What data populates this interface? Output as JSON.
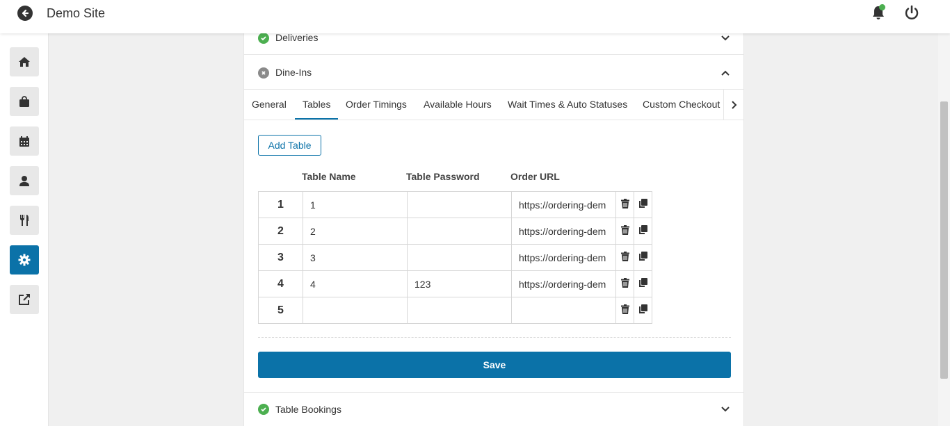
{
  "header": {
    "title": "Demo Site"
  },
  "sidebar": {
    "items": [
      {
        "icon": "home-icon"
      },
      {
        "icon": "shopping-bag-icon"
      },
      {
        "icon": "calendar-icon"
      },
      {
        "icon": "user-icon"
      },
      {
        "icon": "utensils-icon"
      },
      {
        "icon": "gear-icon",
        "active": true
      },
      {
        "icon": "external-link-icon"
      }
    ]
  },
  "sections": {
    "deliveries": "Deliveries",
    "dine_ins": "Dine-Ins",
    "table_bookings": "Table Bookings"
  },
  "tabs": [
    "General",
    "Tables",
    "Order Timings",
    "Available Hours",
    "Wait Times & Auto Statuses",
    "Custom Checkout F"
  ],
  "active_tab": "Tables",
  "buttons": {
    "add_table": "Add Table",
    "save": "Save"
  },
  "table": {
    "headers": {
      "name": "Table Name",
      "password": "Table Password",
      "url": "Order URL"
    },
    "rows": [
      {
        "num": "1",
        "name": "1",
        "password": "",
        "url": "https://ordering-dem"
      },
      {
        "num": "2",
        "name": "2",
        "password": "",
        "url": "https://ordering-dem"
      },
      {
        "num": "3",
        "name": "3",
        "password": "",
        "url": "https://ordering-dem"
      },
      {
        "num": "4",
        "name": "4",
        "password": "123",
        "url": "https://ordering-dem"
      },
      {
        "num": "5",
        "name": "",
        "password": "",
        "url": ""
      }
    ]
  },
  "colors": {
    "accent": "#0b72a8",
    "success": "#4caf50",
    "notification": "#4caf50"
  }
}
